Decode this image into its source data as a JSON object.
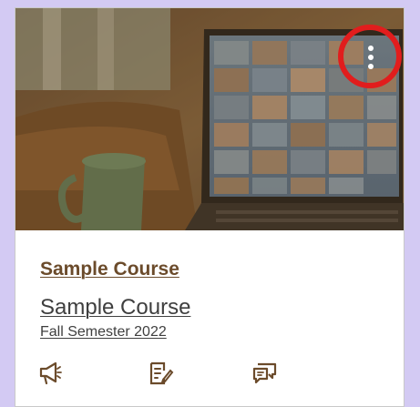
{
  "card": {
    "course_name": "Sample Course",
    "course_code": "Sample Course",
    "term": "Fall Semester 2022",
    "actions": [
      {
        "icon": "announcements-icon"
      },
      {
        "icon": "assignments-icon"
      },
      {
        "icon": "discussions-icon"
      }
    ],
    "options_icon": "more-options-icon",
    "highlight_color": "#e11d1d",
    "accent_color": "#6b4b2b"
  }
}
